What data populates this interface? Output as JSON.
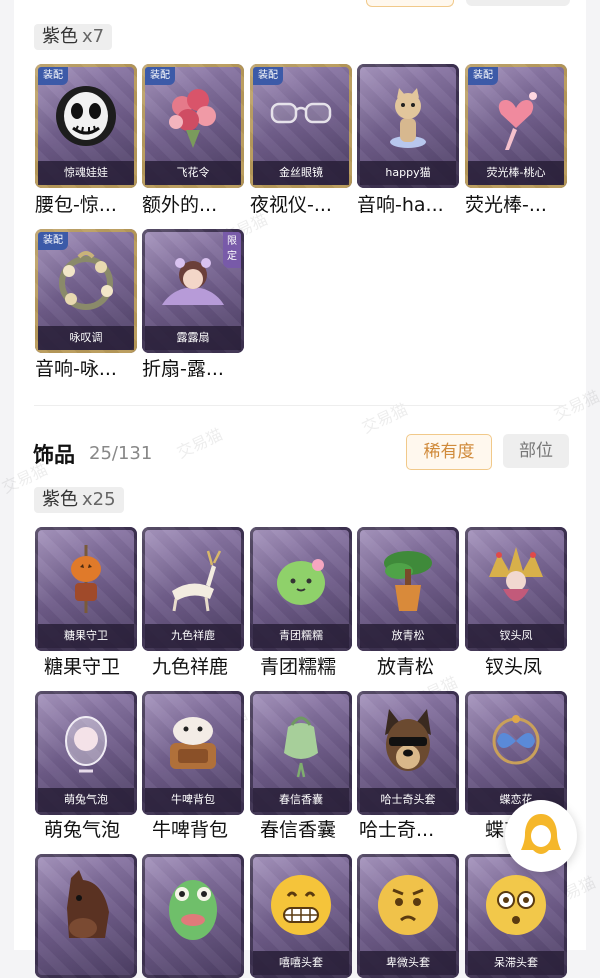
{
  "purple_section": {
    "tag_label": "紫色",
    "tag_count": "x7",
    "items": [
      {
        "caption": "惊魂娃娃",
        "name": "腰包-惊...",
        "badge": "装配",
        "art": "skull-mask"
      },
      {
        "caption": "飞花令",
        "name": "额外的...",
        "badge": "装配",
        "art": "flower-bouquet"
      },
      {
        "caption": "金丝眼镜",
        "name": "夜视仪-...",
        "badge": "装配",
        "art": "glasses"
      },
      {
        "caption": "happy猫",
        "name": "音响-ha...",
        "badge": "",
        "art": "cat-figure"
      },
      {
        "caption": "荧光棒-桃心",
        "name": "荧光棒-...",
        "badge": "装配",
        "art": "heart-wand"
      },
      {
        "caption": "咏叹调",
        "name": "音响-咏...",
        "badge": "装配",
        "art": "flower-wreath"
      },
      {
        "caption": "露露扇",
        "name": "折扇-露...",
        "badge": "限定",
        "art": "girl-fan"
      }
    ]
  },
  "accessories": {
    "title": "饰品",
    "count": "25/131",
    "sort_rarity": "稀有度",
    "sort_slot": "部位",
    "tag_label": "紫色",
    "tag_count": "x25",
    "items": [
      {
        "caption": "糖果守卫",
        "name": "糖果守卫",
        "art": "pumpkin-scarecrow"
      },
      {
        "caption": "九色祥鹿",
        "name": "九色祥鹿",
        "art": "deer"
      },
      {
        "caption": "青团糯糯",
        "name": "青团糯糯",
        "art": "green-dumpling"
      },
      {
        "caption": "放青松",
        "name": "放青松",
        "art": "pine-pot"
      },
      {
        "caption": "钗头凤",
        "name": "钗头凤",
        "art": "phoenix-crown"
      },
      {
        "caption": "萌兔气泡",
        "name": "萌兔气泡",
        "art": "bunny-bubble"
      },
      {
        "caption": "牛啤背包",
        "name": "牛啤背包",
        "art": "cow-backpack"
      },
      {
        "caption": "春信香囊",
        "name": "春信香囊",
        "art": "sachet"
      },
      {
        "caption": "哈士奇头套",
        "name": "哈士奇...",
        "art": "husky-head"
      },
      {
        "caption": "蝶恋花",
        "name": "蝶恋花",
        "art": "butterfly-hairpin"
      },
      {
        "caption": "",
        "name": "",
        "art": "horse-head"
      },
      {
        "caption": "",
        "name": "",
        "art": "fish-head"
      },
      {
        "caption": "嘻嘻头套",
        "name": "",
        "art": "grin-emoji"
      },
      {
        "caption": "卑微头套",
        "name": "",
        "art": "pleading-emoji"
      },
      {
        "caption": "呆滞头套",
        "name": "",
        "art": "dazed-emoji"
      }
    ]
  },
  "watermark": "交易猫"
}
